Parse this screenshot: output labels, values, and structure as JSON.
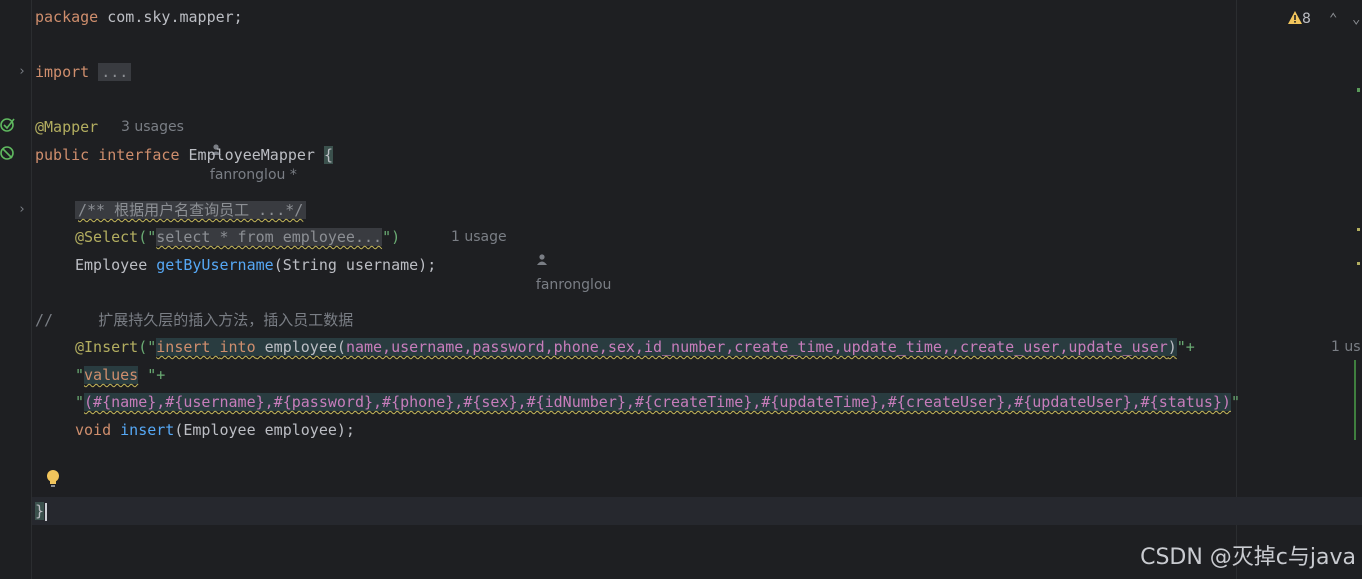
{
  "code": {
    "package_kw": "package",
    "package_name": " com.sky.mapper;",
    "import_kw": "import",
    "import_fold": "...",
    "mapper_annotation": "@Mapper",
    "interface_public": "public",
    "interface_kw": "interface",
    "interface_name": " EmployeeMapper ",
    "open_brace": "{",
    "doc_fold": "/** 根据用户名查询员工 ...*/",
    "select_annotation": "@Select",
    "select_open": "(\"",
    "select_sql": "select * from employee...",
    "select_close": "\")",
    "employee_type": "Employee ",
    "get_method": "getByUsername",
    "get_params": "(String username);",
    "comment_line": "//     扩展持久层的插入方法，插入员工数据",
    "insert_annotation": "@Insert",
    "insert_open": "(\"",
    "insert_kw1": "insert",
    "insert_kw2": "into",
    "insert_table": " employee(",
    "insert_cols": "name,username,password,phone,sex,id_number,create_time,update_time,,create_user,update_user",
    "insert_close": ")",
    "insert_tail": "\"+",
    "values_open": "\"",
    "values_kw": "values",
    "values_tail": " \"+",
    "params_open": "\"",
    "params_body": "(#{name},#{username},#{password},#{phone},#{sex},#{idNumber},#{createTime},#{updateTime},#{createUser},#{updateUser},#{status})",
    "params_tail": "\"",
    "void_kw": "void",
    "insert_method": "insert",
    "insert_params": "(Employee employee);",
    "close_brace": "}"
  },
  "hints": {
    "mapper_usages": "3 usages",
    "mapper_author": "fanronglou *",
    "select_usages": "1 usage",
    "select_author": "fanronglou",
    "insert_usages": "1 us"
  },
  "inspections": {
    "warning_count": "8"
  },
  "watermark": "CSDN @灭掉c与java",
  "colors": {
    "background": "#1e1f22",
    "keyword": "#cf8e6d",
    "annotation": "#b3ae60",
    "method": "#56a8f5",
    "string": "#6aab73",
    "sql_column": "#c77dbb",
    "comment": "#7a7e85",
    "warning": "#f2c55c"
  }
}
